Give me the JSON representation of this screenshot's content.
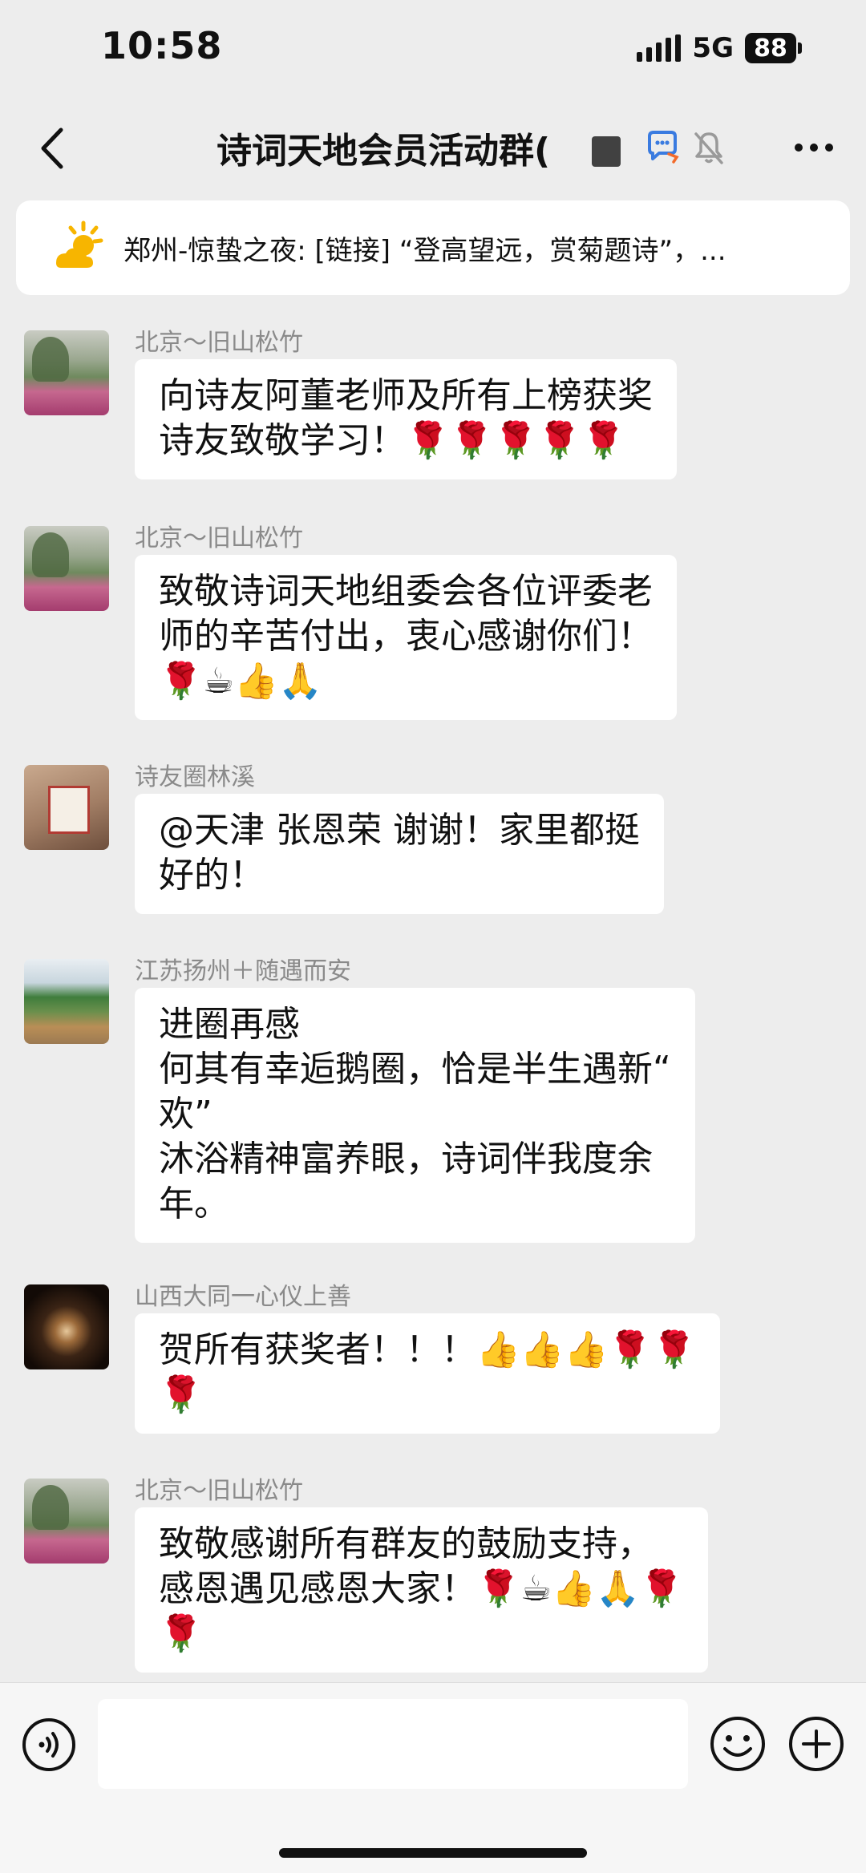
{
  "status_bar": {
    "time": "10:58",
    "network": "5G",
    "battery": "88"
  },
  "nav": {
    "title": "诗词天地会员活动群("
  },
  "announcement": {
    "icon": "sun-cloud-icon",
    "text": "郑州-惊蛰之夜: [链接] “登高望远，赏菊题诗”，..."
  },
  "messages": [
    {
      "sender": "北京～旧山松竹",
      "avatar": "garden",
      "lines": [
        "向诗友阿董老师及所有上榜获奖",
        "诗友致敬学习！🌹🌹🌹🌹🌹"
      ]
    },
    {
      "sender": "北京～旧山松竹",
      "avatar": "garden",
      "lines": [
        "致敬诗词天地组委会各位评委老",
        "师的辛苦付出，衷心感谢你们！",
        "🌹☕👍🙏"
      ]
    },
    {
      "sender": "诗友圈林溪",
      "avatar": "seal",
      "lines": [
        "@天津  张恩荣 谢谢！家里都挺",
        "好的！"
      ]
    },
    {
      "sender": "江苏扬州＋随遇而安",
      "avatar": "landscape",
      "lines": [
        "进圈再感",
        "何其有幸逅鹅圈，恰是半生遇新“",
        "欢”",
        "沐浴精神富养眼，诗词伴我度余",
        "年。"
      ]
    },
    {
      "sender": "山西大同一心仪上善",
      "avatar": "fireworks",
      "lines": [
        "贺所有获奖者！！！👍👍👍🌹🌹",
        "🌹"
      ]
    },
    {
      "sender": "北京～旧山松竹",
      "avatar": "garden",
      "lines": [
        "致敬感谢所有群友的鼓励支持，",
        "感恩遇见感恩大家！🌹☕👍🙏🌹",
        "🌹"
      ]
    }
  ],
  "input": {
    "placeholder": ""
  },
  "colors": {
    "background": "#ededed",
    "bubble": "#ffffff",
    "sender_text": "#8a8a8a",
    "notice_sun": "#f7b500"
  }
}
